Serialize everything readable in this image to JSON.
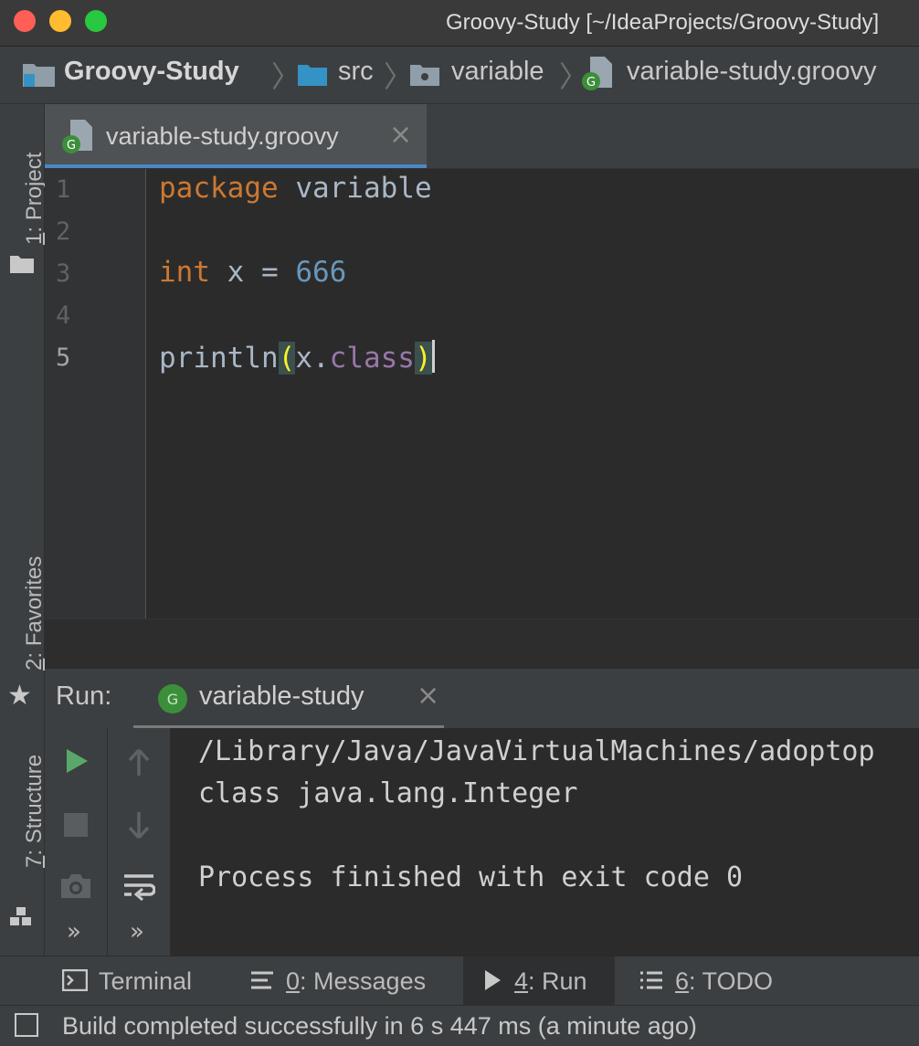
{
  "window": {
    "title": "Groovy-Study [~/IdeaProjects/Groovy-Study]",
    "traffic_lights": {
      "close": "#ff5f57",
      "minimize": "#febc2e",
      "zoom": "#28c840"
    }
  },
  "breadcrumb": {
    "items": [
      {
        "label": "Groovy-Study",
        "icon": "project-folder-icon"
      },
      {
        "label": "src",
        "icon": "source-folder-icon"
      },
      {
        "label": "variable",
        "icon": "package-icon"
      },
      {
        "label": "variable-study.groovy",
        "icon": "groovy-file-icon"
      }
    ]
  },
  "left_strip": {
    "project": {
      "num": "1",
      "label": ": Project"
    },
    "favorites": {
      "num": "2",
      "label": ": Favorites"
    },
    "structure": {
      "num": "7",
      "label": ": Structure"
    }
  },
  "editor": {
    "tab": {
      "label": "variable-study.groovy",
      "close": "×"
    },
    "line_numbers": [
      "1",
      "2",
      "3",
      "4",
      "5"
    ],
    "lines": {
      "l1": {
        "kw": "package",
        "rest": " variable"
      },
      "l3": {
        "kw": "int",
        "mid": " x = ",
        "num": "666"
      },
      "l5": {
        "fn": "println",
        "open": "(",
        "obj": "x.",
        "prop": "class",
        "close": ")"
      }
    }
  },
  "run": {
    "label": "Run:",
    "tab": {
      "label": "variable-study",
      "close": "×"
    },
    "output": [
      "/Library/Java/JavaVirtualMachines/adoptop",
      "class java.lang.Integer",
      "",
      "Process finished with exit code 0"
    ],
    "more": "»"
  },
  "bottom_tabs": [
    {
      "key": "",
      "label": "Terminal",
      "icon": "terminal-icon"
    },
    {
      "key": "0",
      "label": ": Messages",
      "icon": "messages-icon"
    },
    {
      "key": "4",
      "label": ": Run",
      "icon": "run-icon"
    },
    {
      "key": "6",
      "label": ": TODO",
      "icon": "todo-icon"
    }
  ],
  "status": {
    "message": "Build completed successfully in 6 s 447 ms (a minute ago)"
  }
}
